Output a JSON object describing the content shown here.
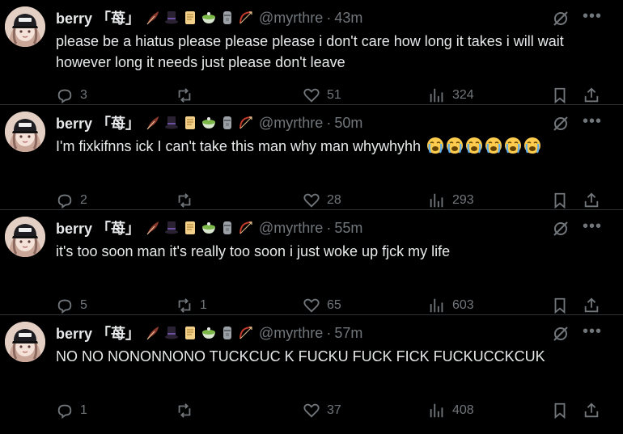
{
  "tweets": [
    {
      "name": "berry 「苺」",
      "handle": "@myrthre",
      "sep": "·",
      "time": "43m",
      "text": "please be a hiatus please please please i don't care how long it takes i will wait however long it needs just please don't leave",
      "emoji_suffix": [],
      "replies": "3",
      "reposts": "",
      "likes": "51",
      "views": "324"
    },
    {
      "name": "berry 「苺」",
      "handle": "@myrthre",
      "sep": "·",
      "time": "50m",
      "text": "I'm fixkifnns ick I can't take this man why man whywhyhh",
      "emoji_suffix": [
        "crying-face",
        "crying-face",
        "crying-face",
        "crying-face",
        "crying-face",
        "crying-face"
      ],
      "replies": "2",
      "reposts": "",
      "likes": "28",
      "views": "293"
    },
    {
      "name": "berry 「苺」",
      "handle": "@myrthre",
      "sep": "·",
      "time": "55m",
      "text": "it's too soon man it's really too soon i just woke up fjck my life",
      "emoji_suffix": [],
      "replies": "5",
      "reposts": "1",
      "likes": "65",
      "views": "603"
    },
    {
      "name": "berry 「苺」",
      "handle": "@myrthre",
      "sep": "·",
      "time": "57m",
      "text": "NO NO NONONNONO TUCKCUC K FUCKU FUCK FICK FUCKUCCKCUK",
      "emoji_suffix": [],
      "replies": "1",
      "reposts": "",
      "likes": "37",
      "views": "408"
    }
  ],
  "name_emojis": [
    "feather-icon",
    "top-hat-icon",
    "scroll-icon",
    "matcha-icon",
    "moai-icon",
    "bow-arrow-icon"
  ],
  "colors": {
    "background": "#000000",
    "text": "#e7e9ea",
    "muted": "#71767b",
    "divider": "#2f3336"
  }
}
